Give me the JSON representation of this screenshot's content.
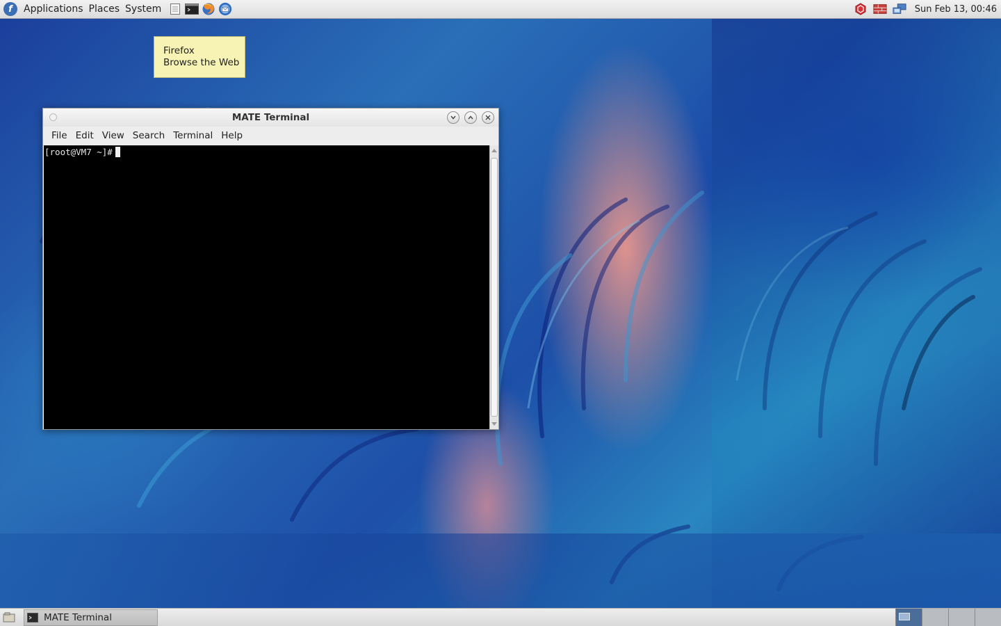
{
  "top_panel": {
    "menus": [
      "Applications",
      "Places",
      "System"
    ],
    "launchers": [
      "text-editor-icon",
      "terminal-icon",
      "firefox-icon",
      "thunderbird-icon"
    ],
    "clock": "Sun Feb 13, 00:46"
  },
  "tooltip": {
    "title": "Firefox",
    "subtitle": "Browse the Web"
  },
  "terminal": {
    "title": "MATE Terminal",
    "menu": [
      "File",
      "Edit",
      "View",
      "Search",
      "Terminal",
      "Help"
    ],
    "prompt": "[root@VM7 ~]#"
  },
  "bottom_panel": {
    "task_label": "MATE Terminal",
    "workspace_count": 4,
    "active_workspace": 1
  }
}
